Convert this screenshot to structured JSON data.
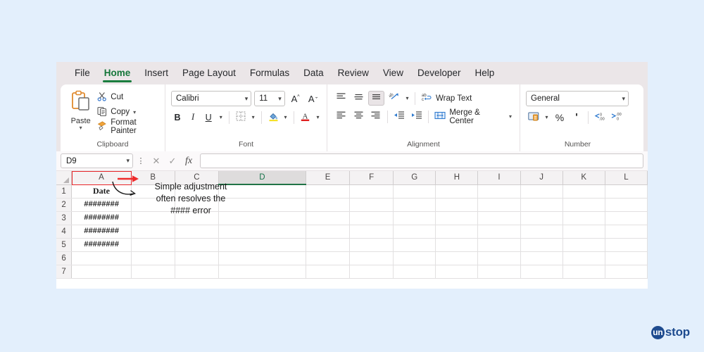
{
  "app": {
    "background_color": "#e3effc",
    "ribbon_bg": "#ebe6e8",
    "accent_green": "#217346",
    "highlight_red": "#e8262a"
  },
  "tabs": [
    {
      "label": "File",
      "active": false
    },
    {
      "label": "Home",
      "active": true
    },
    {
      "label": "Insert",
      "active": false
    },
    {
      "label": "Page Layout",
      "active": false
    },
    {
      "label": "Formulas",
      "active": false
    },
    {
      "label": "Data",
      "active": false
    },
    {
      "label": "Review",
      "active": false
    },
    {
      "label": "View",
      "active": false
    },
    {
      "label": "Developer",
      "active": false
    },
    {
      "label": "Help",
      "active": false
    }
  ],
  "ribbon": {
    "clipboard": {
      "group_label": "Clipboard",
      "paste_label": "Paste",
      "paste_icon": "clipboard-icon",
      "items": [
        {
          "label": "Cut",
          "icon": "scissors-icon",
          "has_caret": false
        },
        {
          "label": "Copy",
          "icon": "copy-icon",
          "has_caret": true
        },
        {
          "label": "Format Painter",
          "icon": "paintbrush-icon",
          "has_caret": false
        }
      ]
    },
    "font": {
      "group_label": "Font",
      "font_family": "Calibri",
      "font_size": "11",
      "grow_font": "A",
      "shrink_font": "A",
      "bold": "B",
      "italic": "I",
      "underline": "U",
      "borders_icon": "borders-icon",
      "fill_color_icon": "fill-color-icon",
      "font_color_icon": "font-color-icon"
    },
    "alignment": {
      "group_label": "Alignment",
      "top_align_icon": "align-top-icon",
      "middle_align_icon": "align-middle-icon",
      "bottom_align_icon": "align-bottom-icon",
      "orientation_icon": "orientation-icon",
      "wrap_text_label": "Wrap Text",
      "wrap_text_icon": "wrap-text-icon",
      "align_left_icon": "align-left-icon",
      "align_center_icon": "align-center-icon",
      "align_right_icon": "align-right-icon",
      "decrease_indent_icon": "decrease-indent-icon",
      "increase_indent_icon": "increase-indent-icon",
      "merge_center_label": "Merge & Center",
      "merge_center_icon": "merge-center-icon"
    },
    "number": {
      "group_label": "Number",
      "format": "General",
      "accounting_icon": "accounting-format-icon",
      "percent_label": "%",
      "comma_label": "'",
      "increase_decimal_icon": "increase-decimal-icon",
      "decrease_decimal_icon": "decrease-decimal-icon"
    }
  },
  "formula_bar": {
    "name_box": "D9",
    "kebab_icon": "more-options-icon",
    "cancel_icon": "cancel-icon",
    "enter_icon": "enter-icon",
    "fx_icon": "fx",
    "formula_value": ""
  },
  "grid": {
    "columns": [
      "A",
      "B",
      "C",
      "D",
      "E",
      "F",
      "G",
      "H",
      "I",
      "J",
      "K",
      "L"
    ],
    "active_column": "D",
    "highlighted_column": "A",
    "rows": [
      "1",
      "2",
      "3",
      "4",
      "5",
      "6",
      "7"
    ],
    "cells": {
      "A1": "Date",
      "A2": "########",
      "A3": "########",
      "A4": "########",
      "A5": "########"
    }
  },
  "annotation": {
    "lines": [
      "Simple adjustment",
      "often resolves the",
      "#### error"
    ],
    "arrow_icon": "curved-arrow-icon",
    "column_arrow_icon": "red-right-arrow-icon"
  },
  "watermark": {
    "circle_text": "un",
    "text": "stop"
  }
}
